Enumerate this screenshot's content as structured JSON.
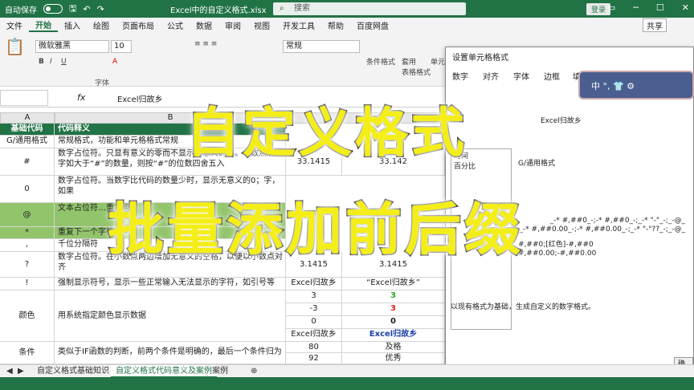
{
  "titlebar": {
    "autosave": "自动保存",
    "doc_title": "Excel中的自定义格式.xlsx",
    "search_placeholder": "搜索",
    "login": "登录"
  },
  "menu": [
    "文件",
    "开始",
    "插入",
    "绘图",
    "页面布局",
    "公式",
    "数据",
    "审阅",
    "视图",
    "开发工具",
    "帮助",
    "百度网盘"
  ],
  "share": "共享",
  "ribbon": {
    "font": "微软雅黑",
    "size": "10",
    "number_format": "常规",
    "font_group_label": "字体",
    "cond_format": "条件格式",
    "table_format": "套用\n表格格式",
    "cell_style": "单元"
  },
  "formula_bar": {
    "fx": "fx",
    "value": "Excel归故乡"
  },
  "columns": [
    "A",
    "B"
  ],
  "table": {
    "header": [
      "基础代码",
      "代码释义"
    ],
    "rows": [
      {
        "code": "G/通用格式",
        "desc": "常规格式，功能和单元格格式常规",
        "c": "",
        "d": ""
      },
      {
        "code": "#",
        "desc": "数字占位符。只显有意义的零而不显示无意义的零。小数点后数字如大于“#”的数量，则按“#”的位数四舍五入",
        "c": "33.1415",
        "d": "33.142"
      },
      {
        "code": "0",
        "desc": "数字占位符。当数字比代码的数量少时，显示无意义的0；字，如果",
        "c": "",
        "d": ""
      },
      {
        "code": "@",
        "desc": "文本占位符…重复原文",
        "c": "",
        "d": ""
      },
      {
        "code": "*",
        "desc": "重复下一个字符",
        "c": "",
        "d": ""
      },
      {
        "code": ",",
        "desc": "千位分隔符",
        "c": "",
        "d": ""
      },
      {
        "code": "?",
        "desc": "数字占位符。在小数点两边增加无意义的空格，以便以小数点对齐",
        "c": "3.1415",
        "d": "3.1415"
      },
      {
        "code": "!",
        "desc": "强制显示符号，显示一些正常输入无法显示的字符，如引号等",
        "c": "Excel归故乡",
        "d": "“Excel归故乡”"
      },
      {
        "code": "颜色",
        "desc": "用系统指定颜色显示数据",
        "c": "3",
        "d": "3"
      },
      {
        "code": "",
        "desc": "",
        "c": "-3",
        "d": "3"
      },
      {
        "code": "",
        "desc": "",
        "c": "0",
        "d": "0"
      },
      {
        "code": "",
        "desc": "",
        "c": "Excel归故乡",
        "d": "Excel归故乡"
      },
      {
        "code": "条件",
        "desc": "类似于IF函数的判断，前两个条件是明确的，最后一个条件归为",
        "c": "80",
        "d": "及格"
      },
      {
        "code": "",
        "desc": "",
        "c": "92",
        "d": "优秀"
      }
    ]
  },
  "dialog": {
    "title": "设置单元格格式",
    "tabs": [
      "数字",
      "对齐",
      "字体",
      "边框",
      "填充"
    ],
    "sample": "Excel归故乡",
    "categories": [
      "时间",
      "百分比"
    ],
    "formats": [
      "G/通用格式",
      "#,##0;[红色]-#,##0",
      "#,##0.00;-#,##0.00",
      "_-* #,##0_-;-* #,##0_-;_-* \"-\"_-;_-@_",
      "_-* #,##0.00_-;-* #,##0.00_-;_-* \"-\"??_-;_-@_"
    ],
    "note": "以现有格式为基础，生成自定义的数字格式。",
    "ok": "确"
  },
  "sheets": [
    "自定义格式基础知识",
    "自定义格式代码意义及案例",
    "案例"
  ],
  "overlay": {
    "line1": "自定义格式",
    "line2": "批量添加前后缀"
  },
  "avatar_bar": "中 °, 👕 ⚙",
  "colors": {
    "excel_green": "#217346",
    "highlight_green": "#92c56b",
    "title_yellow": "#f4ee18",
    "red": "#e02020",
    "green_text": "#22aa22",
    "blue_text": "#1a3fa8"
  }
}
